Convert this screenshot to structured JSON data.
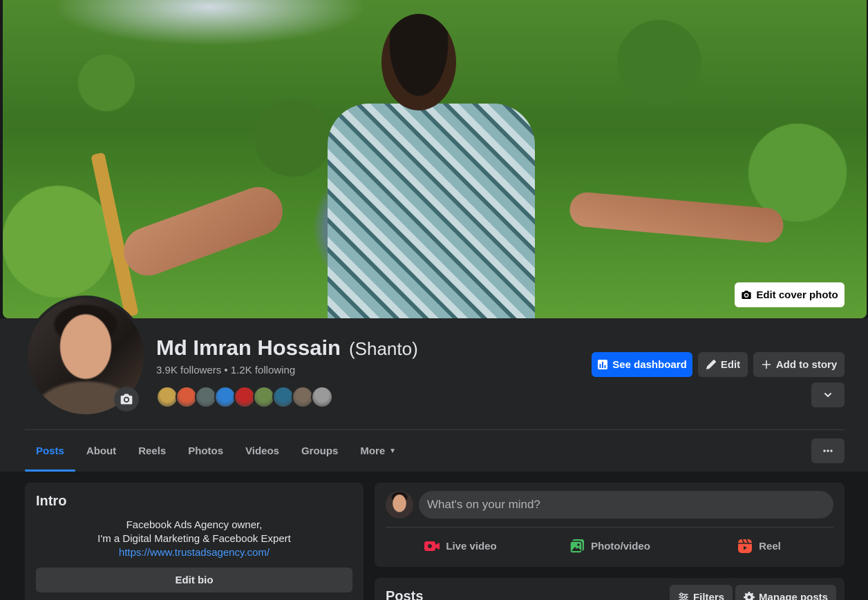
{
  "cover": {
    "edit_label": "Edit cover photo"
  },
  "profile": {
    "name": "Md Imran Hossain",
    "nickname": "(Shanto)",
    "followers_line": "3.9K followers • 1.2K following",
    "friend_colors": [
      "#c8a24a",
      "#d85a3a",
      "#5a6b6a",
      "#2d7fd3",
      "#c02828",
      "#6b8a4a",
      "#2a6a8a",
      "#7a6a5a",
      "#9a9a9a"
    ]
  },
  "actions": {
    "dashboard_label": "See dashboard",
    "edit_label": "Edit",
    "story_label": "Add to story"
  },
  "tabs": [
    {
      "label": "Posts",
      "active": true
    },
    {
      "label": "About"
    },
    {
      "label": "Reels"
    },
    {
      "label": "Photos"
    },
    {
      "label": "Videos"
    },
    {
      "label": "Groups"
    },
    {
      "label": "More",
      "caret": true
    }
  ],
  "intro": {
    "title": "Intro",
    "bio_line1": "Facebook Ads Agency owner,",
    "bio_line2": "I'm a Digital Marketing & Facebook Expert",
    "bio_link": "https://www.trustadsagency.com/",
    "edit_bio_label": "Edit bio"
  },
  "composer": {
    "placeholder": "What's on your mind?",
    "live_label": "Live video",
    "photo_label": "Photo/video",
    "reel_label": "Reel",
    "colors": {
      "live": "#f02849",
      "photo": "#45bd62",
      "reel": "#f5533d"
    }
  },
  "posts": {
    "title": "Posts",
    "filters_label": "Filters",
    "manage_label": "Manage posts"
  }
}
